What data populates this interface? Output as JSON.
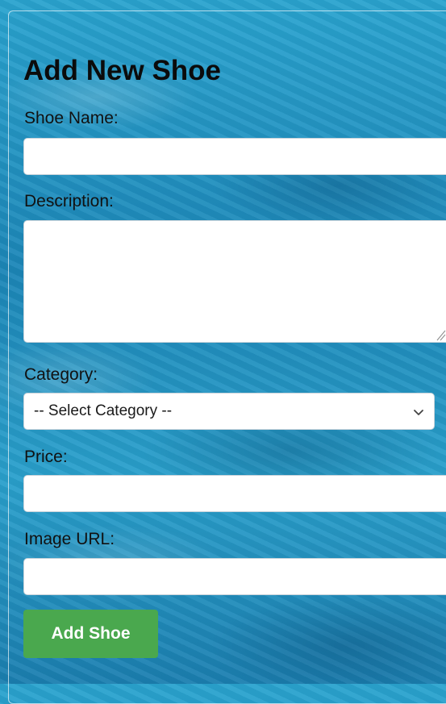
{
  "form": {
    "title": "Add New Shoe",
    "fields": {
      "name": {
        "label": "Shoe Name:",
        "value": ""
      },
      "description": {
        "label": "Description:",
        "value": ""
      },
      "category": {
        "label": "Category:",
        "selected": "-- Select Category --"
      },
      "price": {
        "label": "Price:",
        "value": ""
      },
      "image_url": {
        "label": "Image URL:",
        "value": ""
      }
    },
    "submit_label": "Add Shoe"
  },
  "colors": {
    "background": "#1f8fc0",
    "button": "#4aa84e",
    "button_text": "#ffffff",
    "title_text": "#0b0b0b"
  },
  "icons": {
    "select_arrow": "chevron-down-icon",
    "textarea_resize": "resize-grip-icon"
  }
}
